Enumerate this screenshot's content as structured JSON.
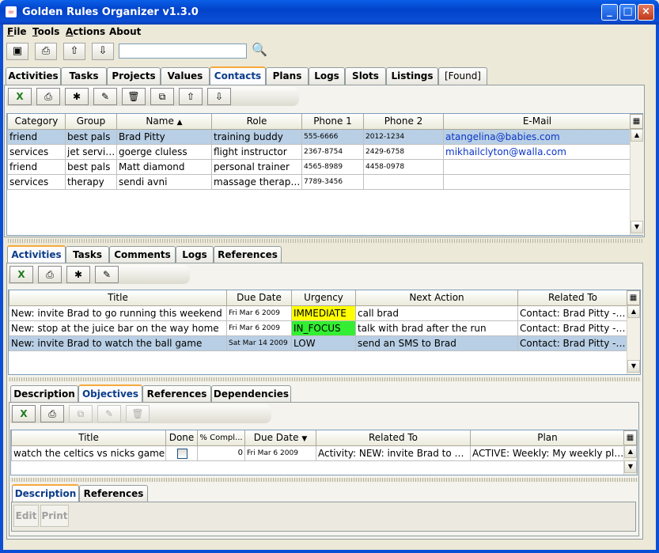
{
  "window": {
    "title": "Golden Rules Organizer v1.3.0"
  },
  "menu": [
    "File",
    "Tools",
    "Actions",
    "About"
  ],
  "toolbar": {
    "search_value": ""
  },
  "main_tabs": [
    "Activities",
    "Tasks",
    "Projects",
    "Values",
    "Contacts",
    "Plans",
    "Logs",
    "Slots",
    "Listings",
    "[Found]"
  ],
  "main_selected_tab": "Contacts",
  "contacts": {
    "columns": [
      "Category",
      "Group",
      "Name",
      "Role",
      "Phone 1",
      "Phone 2",
      "E-Mail"
    ],
    "sort_column": "Name",
    "rows": [
      {
        "category": "friend",
        "group": "best pals",
        "name": "Brad Pitty",
        "role": "training buddy",
        "phone1": "555-6666",
        "phone2": "2012-1234",
        "email": "atangelina@babies.com",
        "selected": true
      },
      {
        "category": "services",
        "group": "jet services",
        "name": "goerge cluless",
        "role": "flight instructor",
        "phone1": "2367-8754",
        "phone2": "2429-6758",
        "email": "mikhailclyton@walla.com",
        "selected": false
      },
      {
        "category": "friend",
        "group": "best pals",
        "name": "Matt diamond",
        "role": "personal trainer",
        "phone1": "4565-8989",
        "phone2": "4458-0978",
        "email": "",
        "selected": false
      },
      {
        "category": "services",
        "group": "therapy",
        "name": "sendi avni",
        "role": "massage therapist",
        "phone1": "7789-3456",
        "phone2": "",
        "email": "",
        "selected": false
      }
    ]
  },
  "detail_tabs": [
    "Activities",
    "Tasks",
    "Comments",
    "Logs",
    "References"
  ],
  "activities": {
    "columns": [
      "Title",
      "Due Date",
      "Urgency",
      "Next Action",
      "Related To"
    ],
    "rows": [
      {
        "title": "New:  invite Brad to go running this weekend",
        "due": "Fri Mar 6 2009",
        "urgency": "IMMEDIATE",
        "urgency_color": "#ffff00",
        "next": "call brad",
        "related": "Contact: Brad Pitty - 555-…",
        "selected": false
      },
      {
        "title": "New:  stop at the juice bar on the way home",
        "due": "Fri Mar 6 2009",
        "urgency": "IN_FOCUS",
        "urgency_color": "#33ee33",
        "next": "talk with brad after the run",
        "related": "Contact: Brad Pitty - 555-…",
        "selected": false
      },
      {
        "title": "New:  invite Brad to watch the ball game",
        "due": "Sat Mar 14 2009",
        "urgency": "LOW",
        "urgency_color": "",
        "next": "send an SMS to Brad",
        "related": "Contact: Brad Pitty - 555-…",
        "selected": true
      }
    ]
  },
  "activity_tabs": [
    "Description",
    "Objectives",
    "References",
    "Dependencies"
  ],
  "objectives": {
    "columns": [
      "Title",
      "Done",
      "% Compl...",
      "Due Date",
      "Related To",
      "Plan"
    ],
    "rows": [
      {
        "title": "watch the celtics vs nicks game",
        "done": false,
        "percent": "0",
        "due": "Fri Mar 6 2009",
        "related": "Activity: NEW: invite Brad to watch ...",
        "plan": "ACTIVE: Weekly: My weekly plan"
      }
    ]
  },
  "objective_tabs": [
    "Description",
    "References"
  ],
  "objective_buttons": {
    "edit": "Edit",
    "print": "Print"
  },
  "colors": {
    "selection": "#b8cfe5",
    "tab_highlight": "#f6a93b",
    "titlebar": "#0242c9"
  }
}
